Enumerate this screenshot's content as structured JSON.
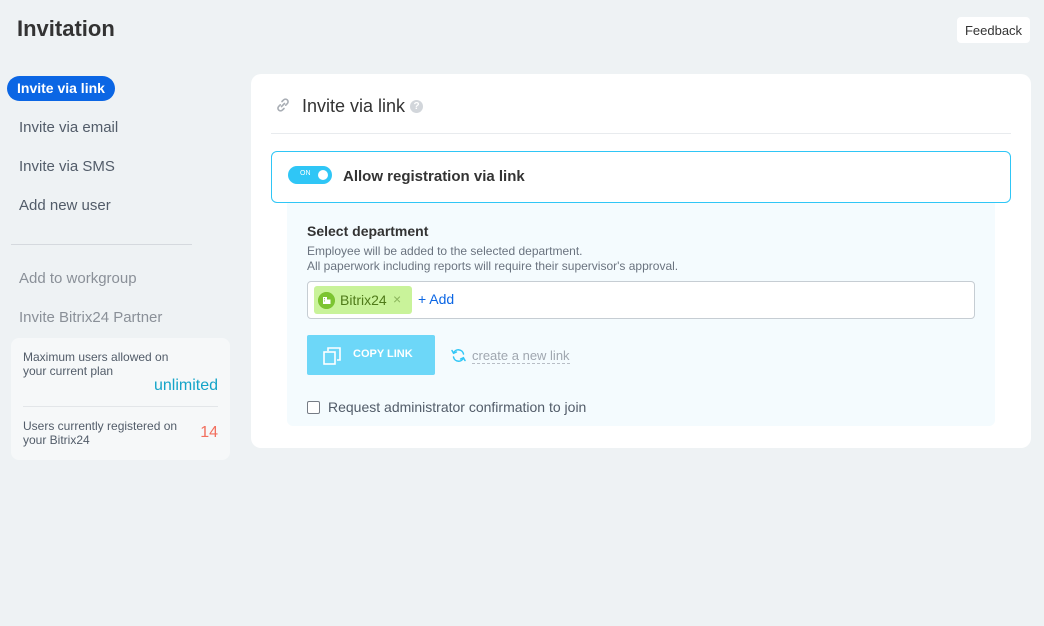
{
  "header": {
    "title": "Invitation",
    "feedback_label": "Feedback"
  },
  "sidebar": {
    "items": [
      {
        "label": "Invite via link",
        "active": true
      },
      {
        "label": "Invite via email"
      },
      {
        "label": "Invite via SMS"
      },
      {
        "label": "Add new user"
      },
      {
        "label": "Add to workgroup"
      },
      {
        "label": "Invite Bitrix24 Partner"
      }
    ],
    "stats": {
      "max_users_label": "Maximum users allowed on your current plan",
      "max_users_value": "unlimited",
      "registered_label": "Users currently registered on your Bitrix24",
      "registered_value": "14"
    }
  },
  "main": {
    "title": "Invite via link",
    "help_glyph": "?",
    "toggle": {
      "state_text": "ON",
      "label": "Allow registration via link",
      "enabled": true
    },
    "department": {
      "title": "Select department",
      "desc_line1": "Employee will be added to the selected department.",
      "desc_line2": "All paperwork including reports will require their supervisor's approval.",
      "tag_label": "Bitrix24",
      "tag_close": "×",
      "add_label": "+ Add"
    },
    "copy_link_label": "COPY LINK",
    "new_link_label": "create a new link",
    "confirm_label": "Request administrator confirmation to join",
    "confirm_checked": false
  },
  "icons": {
    "link": "link-icon",
    "help": "help-icon",
    "department": "department-icon",
    "copy": "copy-icon",
    "refresh": "refresh-icon"
  },
  "colors": {
    "accent_blue": "#0b66e4",
    "toggle_cyan": "#2fc6f6",
    "copy_button": "#6dd7f8",
    "unlimited_text": "#14a4c8",
    "count_text": "#f26f5e",
    "tag_bg": "#c9f39a"
  }
}
